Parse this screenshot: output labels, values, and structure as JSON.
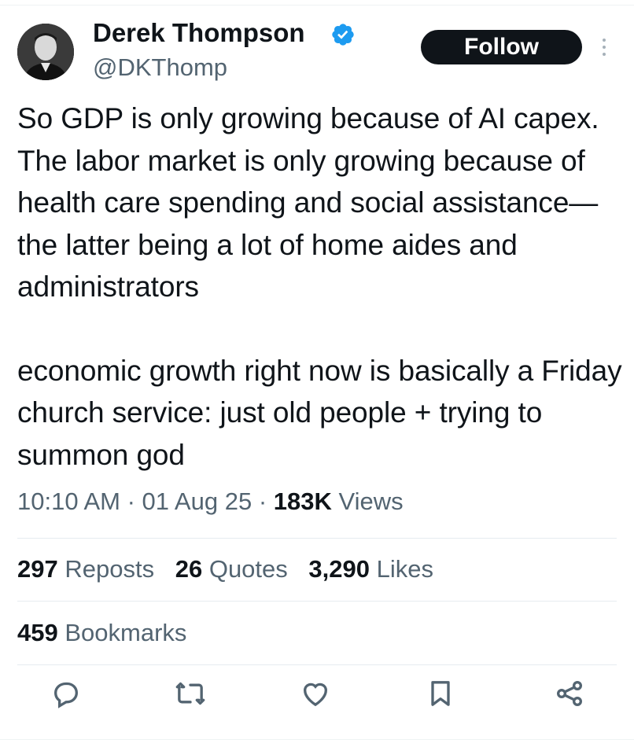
{
  "author": {
    "name": "Derek Thompson",
    "handle": "@DKThomp",
    "verified": true,
    "verified_color": "#1d9bf0"
  },
  "follow_button": {
    "label": "Follow"
  },
  "tweet": {
    "paragraphs": [
      "So GDP is only growing because of AI capex. The labor market is only growing because of health care spending and social assistance—the latter being a lot of home aides and administrators",
      "economic growth right now is basically a Friday church service: just old people + trying to summon god"
    ],
    "time": "10:10 AM",
    "date": "01 Aug 25",
    "views_count": "183K",
    "views_label": "Views"
  },
  "stats": {
    "reposts_count": "297",
    "reposts_label": "Reposts",
    "quotes_count": "26",
    "quotes_label": "Quotes",
    "likes_count": "3,290",
    "likes_label": "Likes",
    "bookmarks_count": "459",
    "bookmarks_label": "Bookmarks"
  },
  "icons": {
    "verified": "verified-badge-icon",
    "more": "more-vertical-icon",
    "reply": "reply-icon",
    "repost": "repost-icon",
    "like": "heart-icon",
    "bookmark": "bookmark-icon",
    "share": "share-icon"
  },
  "colors": {
    "text": "#0f1419",
    "secondary": "#536471",
    "accent": "#1d9bf0"
  }
}
